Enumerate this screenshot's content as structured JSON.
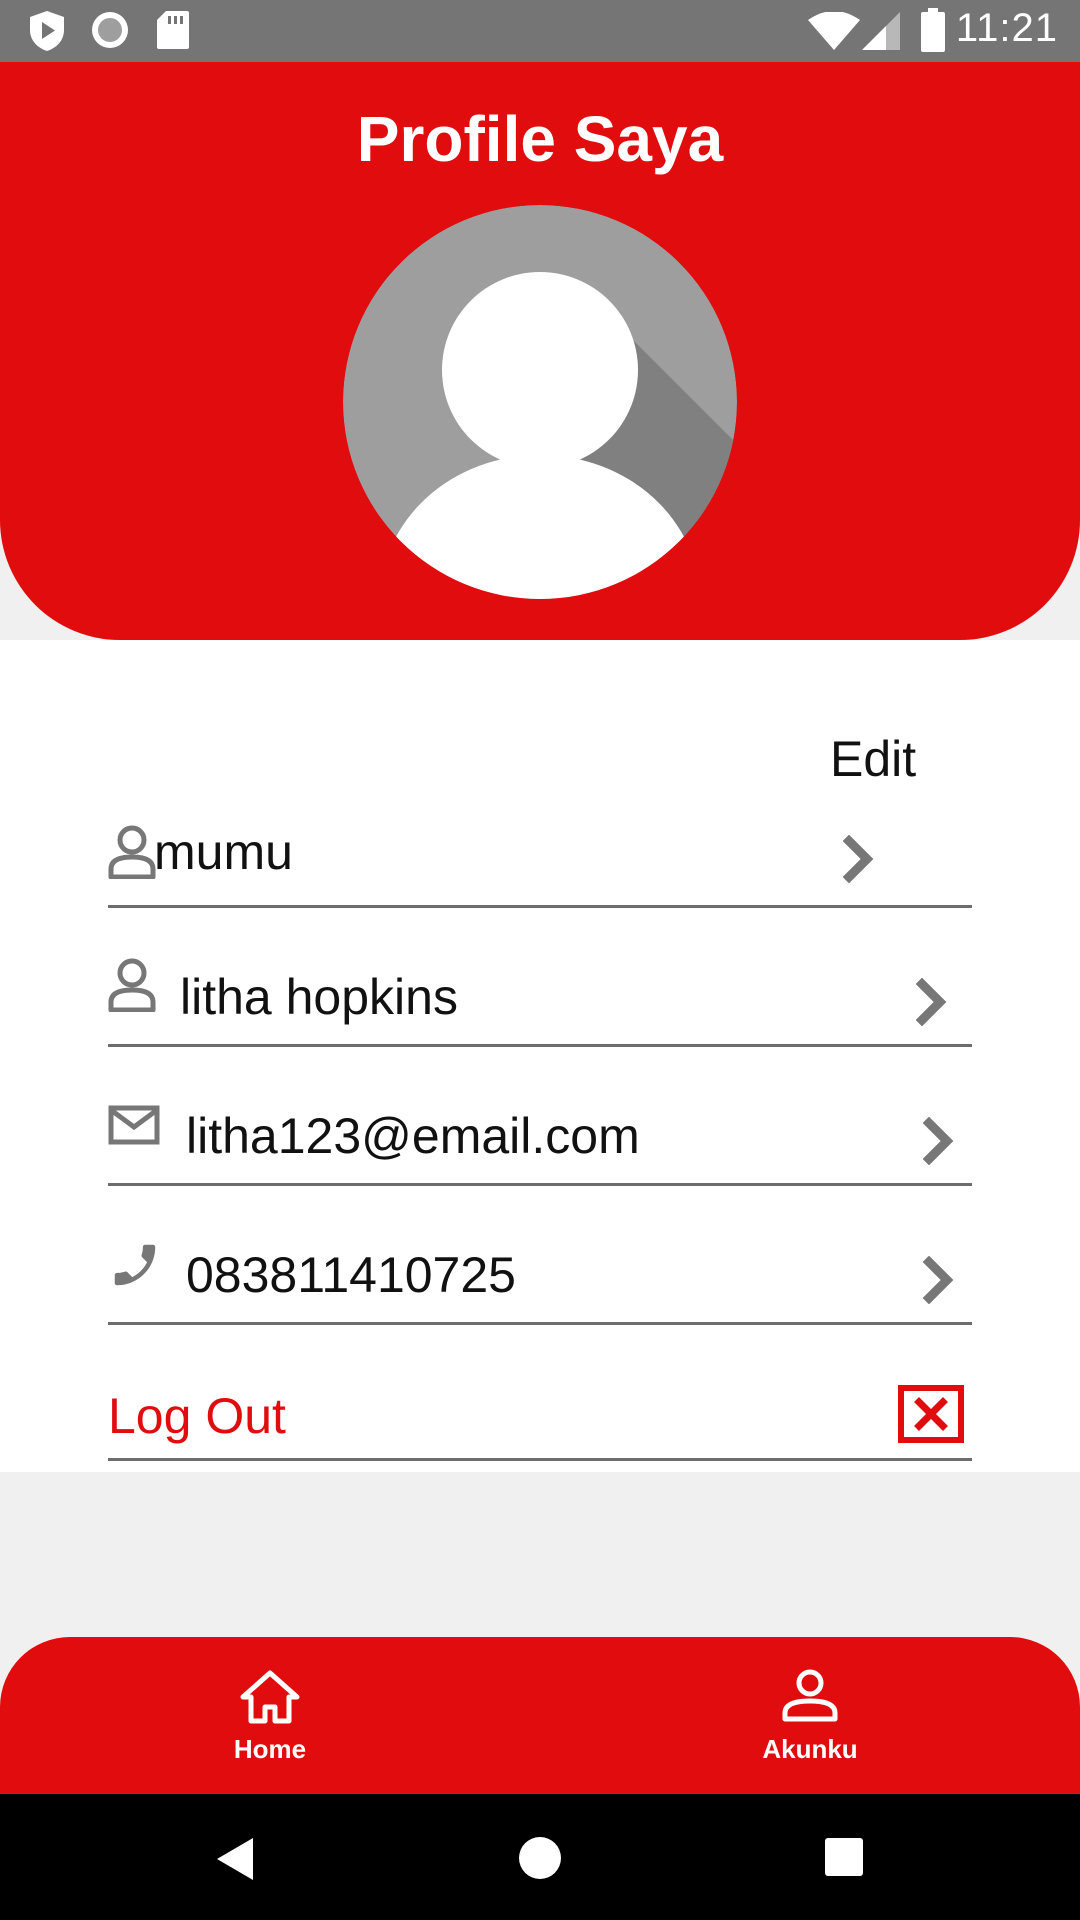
{
  "status_bar": {
    "time": "11:21",
    "left_icons": [
      "play-protect-icon",
      "record-icon",
      "sd-card-icon"
    ],
    "right_icons": [
      "wifi-icon",
      "signal-icon",
      "battery-icon"
    ]
  },
  "header": {
    "title": "Profile Saya",
    "background_color": "#e10c0d"
  },
  "profile": {
    "edit_label": "Edit",
    "fields": [
      {
        "icon": "person-icon",
        "value": "mumu"
      },
      {
        "icon": "person-icon",
        "value": "litha hopkins"
      },
      {
        "icon": "mail-icon",
        "value": "litha123@email.com"
      },
      {
        "icon": "phone-icon",
        "value": "083811410725"
      }
    ],
    "logout_label": "Log Out",
    "logout_icon": "close-box-icon"
  },
  "bottom_nav": {
    "items": [
      {
        "label": "Home",
        "icon": "home-icon"
      },
      {
        "label": "Akunku",
        "icon": "account-icon"
      }
    ]
  },
  "system_nav": {
    "buttons": [
      "back-icon",
      "home-circle-icon",
      "recents-icon"
    ]
  },
  "colors": {
    "accent": "#e10c0d",
    "status_bar": "#757575",
    "divider": "#6d6d6d",
    "icon_gray": "#777777"
  }
}
